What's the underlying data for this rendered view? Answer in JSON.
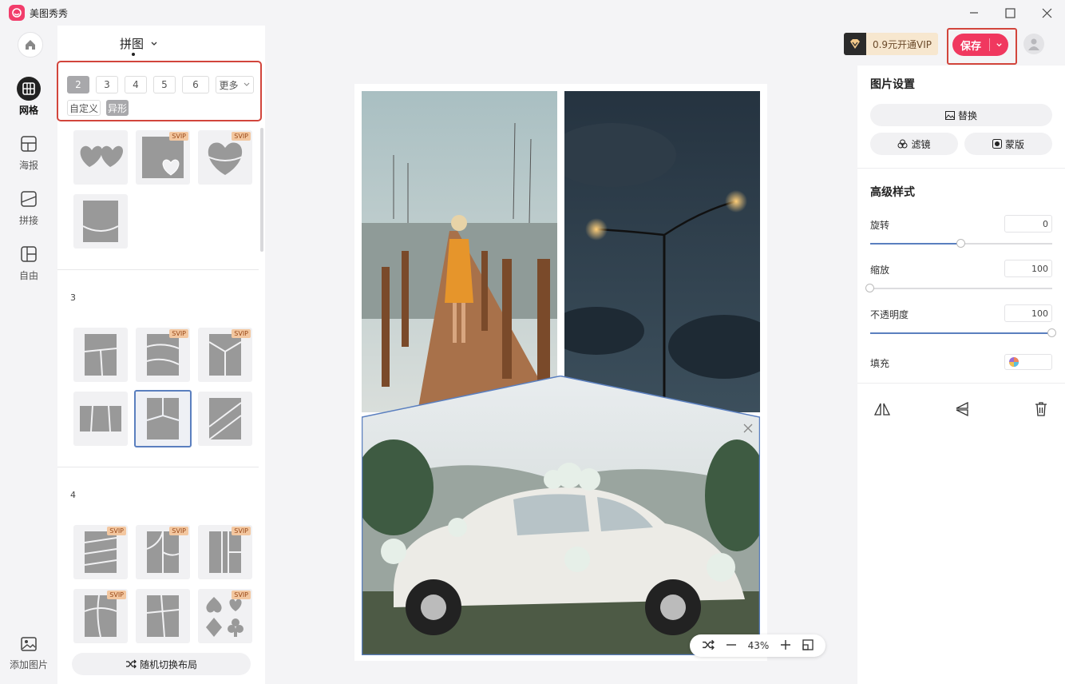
{
  "app": {
    "title": "美图秀秀"
  },
  "mode": {
    "title": "拼图"
  },
  "nav": [
    {
      "label": "网格",
      "icon": "grid-icon",
      "active": true
    },
    {
      "label": "海报",
      "icon": "poster-icon",
      "active": false
    },
    {
      "label": "拼接",
      "icon": "stitch-icon",
      "active": false
    },
    {
      "label": "自由",
      "icon": "freeform-icon",
      "active": false
    }
  ],
  "add_image": {
    "label": "添加图片"
  },
  "counts": [
    "2",
    "3",
    "4",
    "5",
    "6"
  ],
  "selected_count": "2",
  "more_label": "更多",
  "tags": {
    "custom": "自定义",
    "shaped": "异形"
  },
  "sections": {
    "three": "3",
    "four": "4"
  },
  "svip_label": "SVIP",
  "random_layout": "随机切换布局",
  "vip": {
    "text": "0.9元开通VIP"
  },
  "save": {
    "label": "保存"
  },
  "zoom": {
    "level": "43%"
  },
  "right": {
    "image_settings": "图片设置",
    "replace": "替换",
    "filter": "滤镜",
    "mask": "蒙版",
    "advanced": "高级样式",
    "rotate": {
      "label": "旋转",
      "value": "0",
      "fraction": 0.5
    },
    "scale": {
      "label": "缩放",
      "value": "100",
      "fraction": 0.0
    },
    "opacity": {
      "label": "不透明度",
      "value": "100",
      "fraction": 1.0
    },
    "fill": {
      "label": "填充"
    }
  },
  "colors": {
    "accent": "#f0385f",
    "highlight": "#d2453c",
    "selection": "#5a7fbf"
  }
}
